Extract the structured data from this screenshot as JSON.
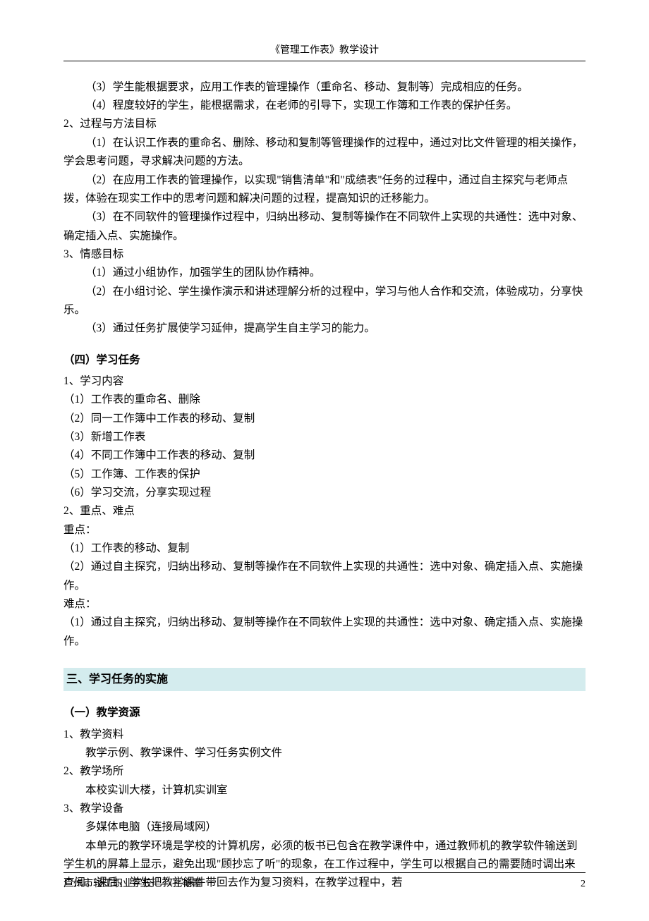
{
  "header": {
    "title": "《管理工作表》教学设计"
  },
  "body": {
    "p1": "（3）学生能根据要求，应用工作表的管理操作（重命名、移动、复制等）完成相应的任务。",
    "p2": "（4）程度较好的学生，能根据需求，在老师的引导下，实现工作簿和工作表的保护任务。",
    "h2": "2、过程与方法目标",
    "p3": "（1）在认识工作表的重命名、删除、移动和复制等管理操作的过程中，通过对比文件管理的相关操作，学会思考问题，寻求解决问题的方法。",
    "p4": "（2）在应用工作表的管理操作，以实现\"销售清单\"和\"成绩表\"任务的过程中，通过自主探究与老师点拨，体验在现实工作中的思考问题和解决问题的过程，提高知识的迁移能力。",
    "p5": "（3）在不同软件的管理操作过程中，归纳出移动、复制等操作在不同软件上实现的共通性：选中对象、确定插入点、实施操作。",
    "h3": "3、情感目标",
    "p6": "（1）通过小组协作，加强学生的团队协作精神。",
    "p7": "（2）在小组讨论、学生操作演示和讲述理解分析的过程中，学习与他人合作和交流，体验成功，分享快乐。",
    "p8": "（3）通过任务扩展使学习延伸，提高学生自主学习的能力。",
    "sec4": "（四）学习任务",
    "s4_1": "1、学习内容",
    "s4_1_1": "（1）工作表的重命名、删除",
    "s4_1_2": "（2）同一工作簿中工作表的移动、复制",
    "s4_1_3": "（3）新增工作表",
    "s4_1_4": "（4）不同工作簿中工作表的移动、复制",
    "s4_1_5": "（5）工作簿、工作表的保护",
    "s4_1_6": "（6）学习交流，分享实现过程",
    "s4_2": "2、重点、难点",
    "s4_2a": "重点：",
    "s4_2a1": "（1）工作表的移动、复制",
    "s4_2a2": "（2）通过自主探究，归纳出移动、复制等操作在不同软件上实现的共通性：选中对象、确定插入点、实施操作。",
    "s4_2b": "难点：",
    "s4_2b1": "（1）通过自主探究，归纳出移动、复制等操作在不同软件上实现的共通性：选中对象、确定插入点、实施操作。",
    "big3": "三、学习任务的实施",
    "sec3_1": "（一）教学资源",
    "r1": "1、教学资料",
    "r1a": "教学示例、教学课件、学习任务实例文件",
    "r2": "2、教学场所",
    "r2a": "本校实训大楼，计算机实训室",
    "r3": "3、教学设备",
    "r3a": "多媒体电脑（连接局域网）",
    "r4": "本单元的教学环境是学校的计算机房，必须的板书已包含在教学课件中，通过教师机的教学软件输送到学生机的屏幕上显示，避免出现\"顾抄忘了听\"的现象，在工作过程中，学生可以根据自己的需要随时调出来查阅。课后，学生把教学课件带回去作为复习资料，在教学过程中，若"
  },
  "footer": {
    "left": "广州市轻工职业学校——孔艳霞",
    "page": "2"
  }
}
